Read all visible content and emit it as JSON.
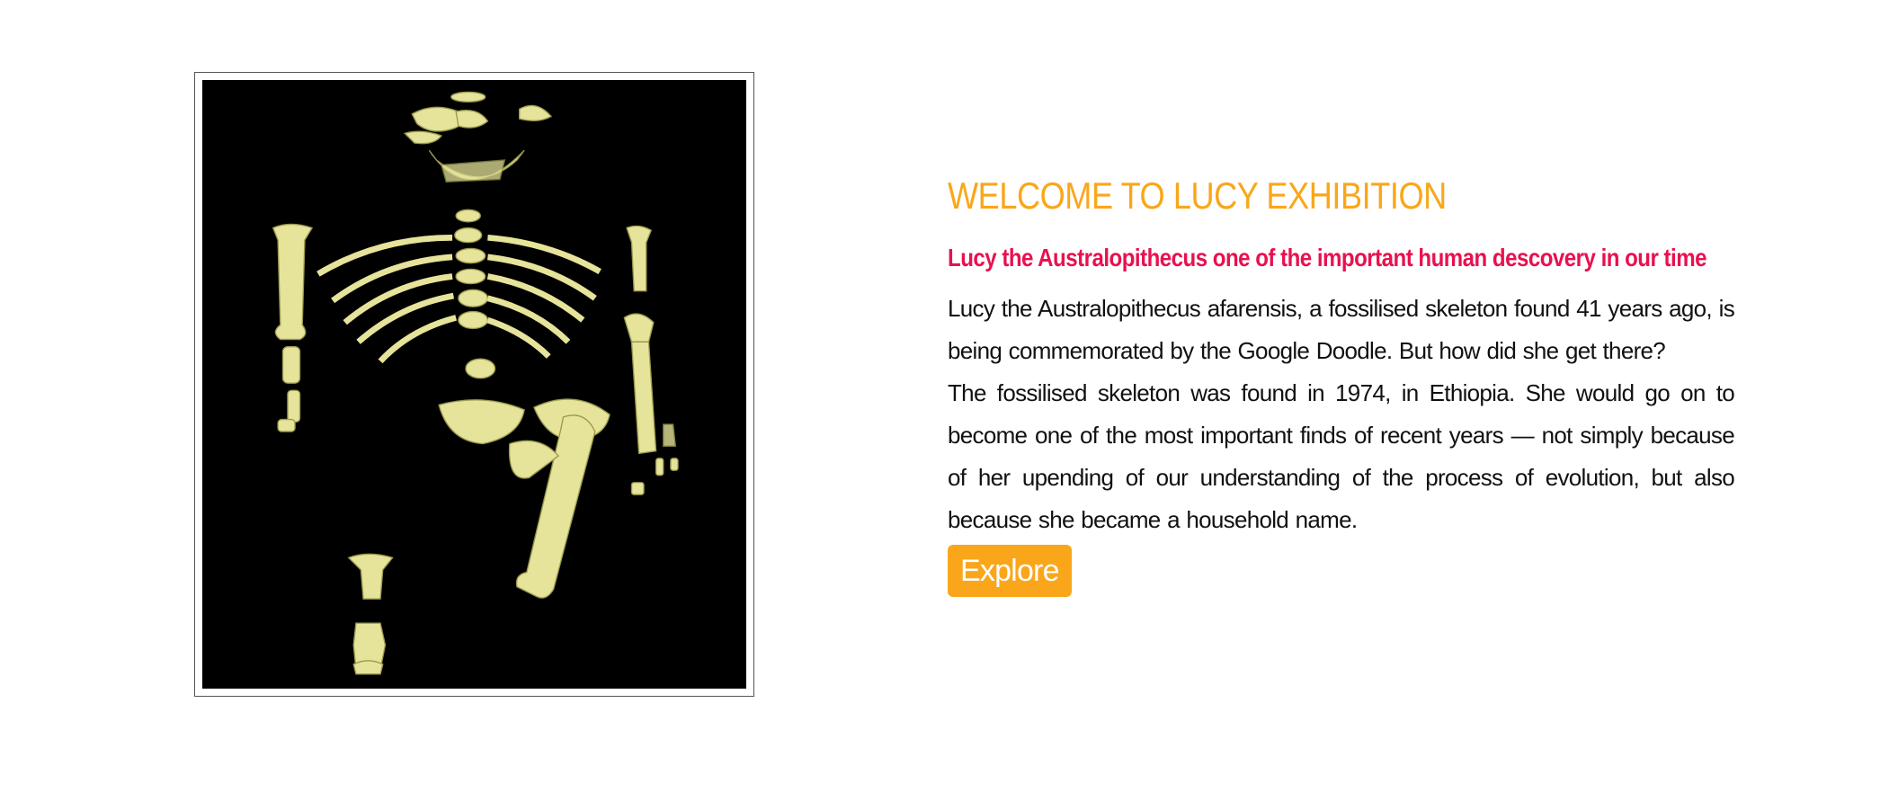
{
  "exhibition": {
    "title": "WELCOME TO LUCY EXHIBITION",
    "subtitle": "Lucy the Australopithecus one of the important human descovery in our time",
    "paragraphs": [
      "Lucy the Australopithecus afarensis, a fossilised skeleton found 41 years ago, is being commemorated by the Google Doodle. But how did she get there?",
      "The fossilised skeleton was found in 1974, in Ethiopia. She would go on to become one of the most important finds of recent years — not simply because of her upending of our understanding of the process of evolution, but also because she became a household name."
    ],
    "button_label": "Explore"
  },
  "colors": {
    "accent": "#FAA61A",
    "subtitle": "#E8114F",
    "text": "#111111",
    "image_bg": "#000000",
    "bone": "#E6E39A"
  },
  "image": {
    "subject": "fossil-skeleton"
  }
}
